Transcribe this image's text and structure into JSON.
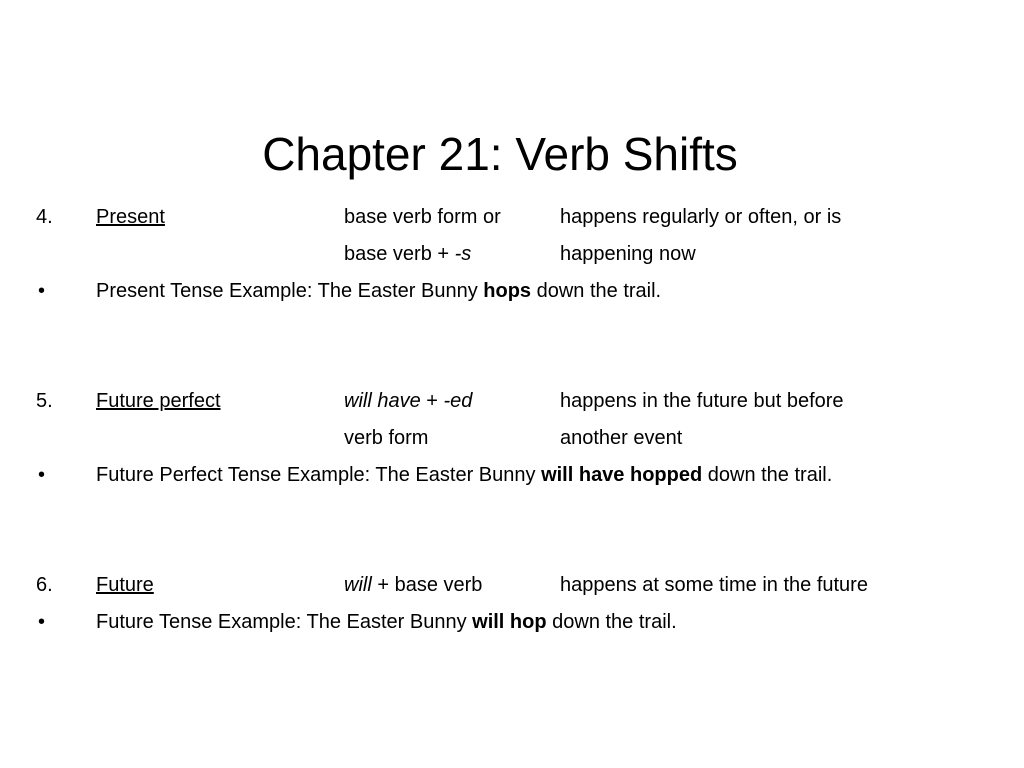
{
  "title": "Chapter 21: Verb Shifts",
  "items": [
    {
      "number": "4.",
      "term": "Present",
      "form_line1": "base verb form or",
      "form_line2_pre": "base verb + ",
      "form_line2_italic": "-s",
      "desc_line1": "happens regularly or often, or is",
      "desc_line2": "happening now",
      "bullet": "•",
      "example_pre": "Present Tense Example: The Easter Bunny ",
      "example_bold": "hops",
      "example_post": " down the trail."
    },
    {
      "number": "5.",
      "term": "Future perfect",
      "form_line1_italic_a": "will have",
      "form_line1_mid": " + ",
      "form_line1_italic_b": "-ed",
      "form_line2": "verb form",
      "desc_line1": "happens in the future but before",
      "desc_line2": "another event",
      "bullet": "•",
      "example_pre": "Future Perfect Tense Example: The Easter Bunny ",
      "example_bold": "will have hopped",
      "example_post": " down the trail."
    },
    {
      "number": "6.",
      "term": "Future",
      "form_italic": "will",
      "form_post": " + base verb",
      "desc_line1": "happens at some time in the future",
      "bullet": "•",
      "example_pre": "Future Tense Example: The Easter Bunny ",
      "example_bold": "will hop",
      "example_post": " down the trail."
    }
  ]
}
